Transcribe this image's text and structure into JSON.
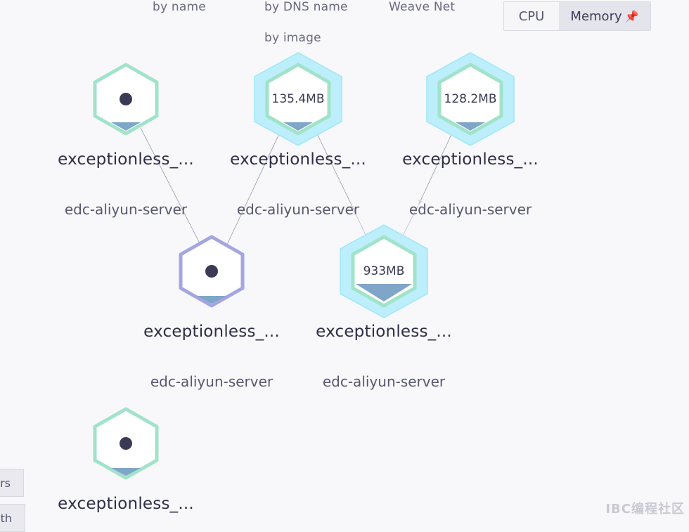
{
  "topology_options": {
    "by_name": "by name",
    "by_dns_name": "by DNS name",
    "weave_net": "Weave Net",
    "by_image": "by image"
  },
  "metric_toggle": {
    "cpu": "CPU",
    "memory": "Memory",
    "selected": "memory"
  },
  "nodes": [
    {
      "label": "exceptionless_...",
      "sub": "edc-aliyun-server",
      "metric": "",
      "fill": 0.08
    },
    {
      "label": "exceptionless_...",
      "sub": "edc-aliyun-server",
      "metric": "135.4MB",
      "fill": 0.08
    },
    {
      "label": "exceptionless_...",
      "sub": "edc-aliyun-server",
      "metric": "128.2MB",
      "fill": 0.08
    },
    {
      "label": "exceptionless_...",
      "sub": "edc-aliyun-server",
      "metric": "",
      "fill": 0.08
    },
    {
      "label": "exceptionless_...",
      "sub": "edc-aliyun-server",
      "metric": "933MB",
      "fill": 0.3
    },
    {
      "label": "exceptionless_...",
      "sub": "",
      "metric": "",
      "fill": 0.08
    }
  ],
  "side_buttons": {
    "first": "rs",
    "second": "th"
  },
  "watermark": "IBC编程社区",
  "colors": {
    "background": "#f8f8fa",
    "hex_border_green": "#a1e3c9",
    "hex_border_purple": "#a3a6e0",
    "highlight_cyan": "#bdeefb",
    "fill_blue": "#7fa5c8",
    "dot": "#3a3a55"
  }
}
